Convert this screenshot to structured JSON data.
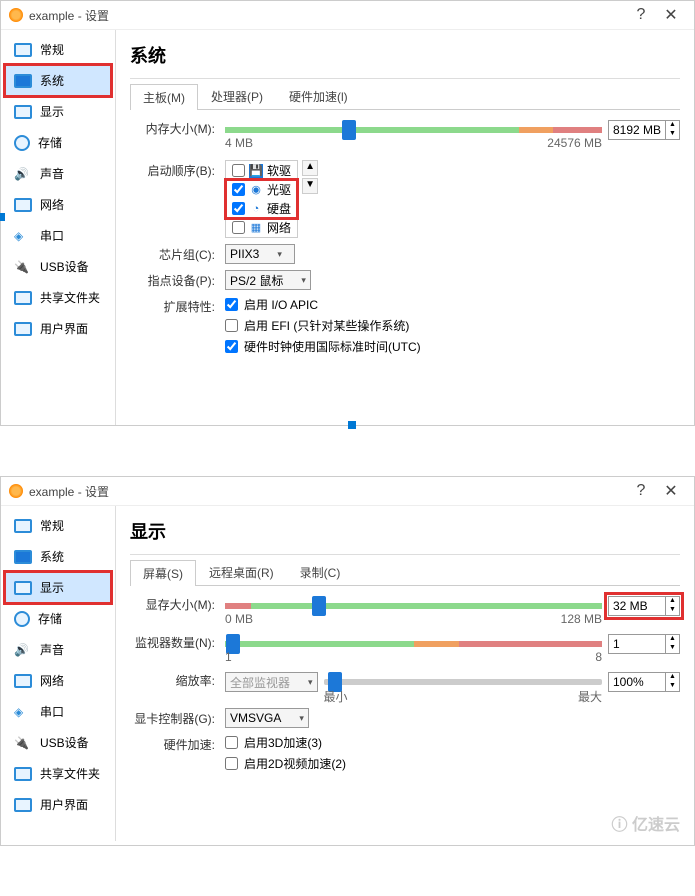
{
  "window": {
    "title": "example - 设置",
    "help": "?",
    "close": "✕"
  },
  "nav": {
    "general": "常规",
    "system": "系统",
    "display": "显示",
    "storage": "存储",
    "audio": "声音",
    "network": "网络",
    "serial": "串口",
    "usb": "USB设备",
    "shared": "共享文件夹",
    "ui": "用户界面"
  },
  "sys": {
    "title": "系统",
    "tabs": {
      "mb": "主板(M)",
      "cpu": "处理器(P)",
      "accel": "硬件加速(l)"
    },
    "mem_label": "内存大小(M):",
    "mem_min": "4 MB",
    "mem_max": "24576 MB",
    "mem_val": "8192 MB",
    "boot_label": "启动顺序(B):",
    "boot": {
      "floppy": "软驱",
      "optical": "光驱",
      "hdd": "硬盘",
      "net": "网络"
    },
    "chipset_label": "芯片组(C):",
    "chipset_val": "PIIX3",
    "pointer_label": "指点设备(P):",
    "pointer_val": "PS/2 鼠标",
    "ext_label": "扩展特性:",
    "ext_ioapic": "启用 I/O APIC",
    "ext_efi": "启用 EFI (只针对某些操作系统)",
    "ext_utc": "硬件时钟使用国际标准时间(UTC)"
  },
  "disp": {
    "title": "显示",
    "tabs": {
      "screen": "屏幕(S)",
      "remote": "远程桌面(R)",
      "record": "录制(C)"
    },
    "vram_label": "显存大小(M):",
    "vram_min": "0 MB",
    "vram_max": "128 MB",
    "vram_val": "32 MB",
    "monitors_label": "监视器数量(N):",
    "mon_min": "1",
    "mon_max": "8",
    "mon_val": "1",
    "scale_label": "缩放率:",
    "scale_target": "全部监视器",
    "scale_min": "最小",
    "scale_max": "最大",
    "scale_val": "100%",
    "controller_label": "显卡控制器(G):",
    "controller_val": "VMSVGA",
    "hwaccel_label": "硬件加速:",
    "accel_3d": "启用3D加速(3)",
    "accel_2d": "启用2D视频加速(2)"
  },
  "watermark": "亿速云"
}
